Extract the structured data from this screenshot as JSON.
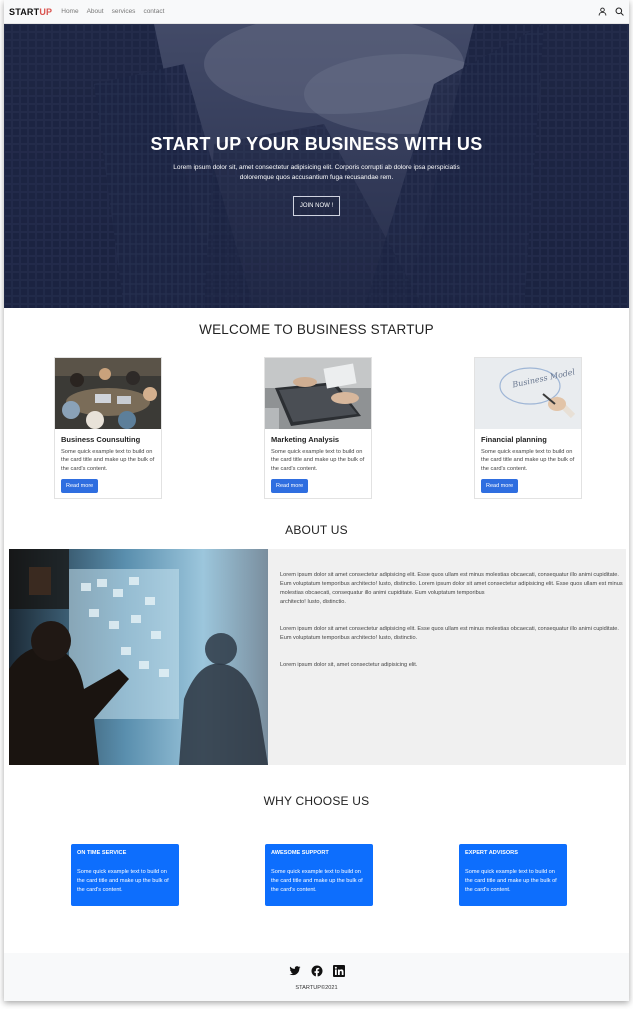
{
  "navbar": {
    "brand_start": "START",
    "brand_up": "UP",
    "links": [
      "Home",
      "About",
      "services",
      "contact"
    ],
    "icons": [
      "user-icon",
      "search-icon"
    ]
  },
  "hero": {
    "title": "START UP YOUR BUSINESS WITH US",
    "text": "Lorem ipsum dolor sit, amet consectetur adipisicing elit. Corporis corrupti ab dolore ipsa perspiciatis doloremque quos accusantium fuga recusandae rem.",
    "button": "JOIN NOW !"
  },
  "welcome": {
    "title": "WELCOME TO BUSINESS STARTUP",
    "cards": [
      {
        "title": "Business Counsulting",
        "text": "Some quick example text to build on the card title and make up the bulk of the card's content.",
        "button": "Read more"
      },
      {
        "title": "Marketing Analysis",
        "text": "Some quick example text to build on the card title and make up the bulk of the card's content.",
        "button": "Read more"
      },
      {
        "title": "Financial planning",
        "text": "Some quick example text to build on the card title and make up the bulk of the card's content.",
        "button": "Read more"
      }
    ],
    "card3_image_text": "Business Model"
  },
  "about": {
    "title": "ABOUT US",
    "p1": "Lorem ipsum dolor sit amet consectetur adipisicing elit. Esse quos ullam est minus molestias obcaecati, consequatur illo animi cupiditate.",
    "p1b": "Eum voluptatum temporibus architecto! Iusto, distinctio. Lorem ipsum dolor sit amet consectetur adipisicing elit. Esse quos ullam est minus molestias obcaecati, consequatur illo animi cupiditate. Eum voluptatum temporibus",
    "p1c": "architecto! Iusto, distinctio.",
    "p2": "Lorem ipsum dolor sit amet consectetur adipisicing elit. Esse quos ullam est minus molestias obcaecati, consequatur illo animi cupiditate. Eum voluptatum temporibus architecto! Iusto, distinctio.",
    "p3": "Lorem ipsum dolor sit, amet consectetur adipisicing elit."
  },
  "why": {
    "title": "WHY CHOOSE US",
    "cards": [
      {
        "title": "ON TIME SERVICE",
        "text": "Some quick example text to build on the card title and make up the bulk of the card's content."
      },
      {
        "title": "AWESOME SUPPORT",
        "text": "Some quick example text to build on the card title and make up the bulk of the card's content."
      },
      {
        "title": "EXPERT ADVISORS",
        "text": "Some quick example text to build on the card title and make up the bulk of the card's content."
      }
    ]
  },
  "footer": {
    "icons": [
      "twitter-icon",
      "facebook-icon",
      "linkedin-icon"
    ],
    "copyright": "STARTUP©2021"
  },
  "colors": {
    "accent": "#0d6efd",
    "button": "#2f6ee0",
    "brand_up": "#d9534f"
  }
}
